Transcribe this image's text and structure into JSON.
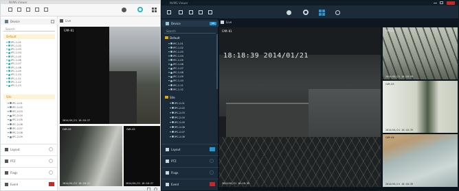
{
  "colors": {
    "light_accent": "#2bb3c0",
    "dark_bg": "#1b2b3a",
    "dark_accent": "#1e9ad6",
    "red": "#c62828"
  },
  "light_window": {
    "title": "NVMS Viewer",
    "icons": [
      "home-icon",
      "play-icon",
      "map-icon",
      "layout-icon",
      "bell-icon",
      "settings-icon",
      "record-icon",
      "grid-icon"
    ],
    "sidebar": {
      "section_device": "Device",
      "search_placeholder": "Search",
      "group1_label": "Default",
      "group1_items": [
        "IPC-1-01",
        "IPC-1-02",
        "IPC-1-03",
        "IPC-1-04",
        "IPC-1-05",
        "IPC-1-06",
        "IPC-1-07",
        "IPC-1-08",
        "IPC-1-09",
        "IPC-1-10",
        "IPC-1-11",
        "IPC-1-12",
        "IPC-1-13"
      ],
      "group2_label": "Site",
      "group2_items": [
        "IPC-2-01",
        "IPC-2-02",
        "IPC-2-03",
        "IPC-2-04",
        "IPC-2-05",
        "IPC-2-06",
        "IPC-2-07",
        "IPC-2-08",
        "IPC-2-09"
      ],
      "bottom_items": [
        {
          "label": "Layout",
          "icon": "layout-icon"
        },
        {
          "label": "PTZ",
          "icon": "ptz-icon"
        },
        {
          "label": "Flags",
          "icon": "flag-icon"
        },
        {
          "label": "Event",
          "icon": "alarm-icon"
        }
      ]
    },
    "main_tab": "Live",
    "feeds": [
      {
        "id": "big",
        "top_label": "CAM-01",
        "bottom_label": "2014/01/21 18:18:27"
      },
      {
        "id": "small1",
        "top_label": "CAM-02",
        "bottom_label": "2014/01/21 18:18:27"
      },
      {
        "id": "small2",
        "top_label": "CAM-03",
        "bottom_label": "2014/01/21 18:18:27"
      }
    ]
  },
  "dark_window": {
    "title": "NVMS Viewer",
    "window_controls": [
      "minimize-icon",
      "maximize-icon",
      "close-icon"
    ],
    "sidebar": {
      "section_device": "Device",
      "badge": "ON",
      "search_placeholder": "Search",
      "group1_label": "Default",
      "group1_items": [
        "IPC-1-01",
        "IPC-1-02",
        "IPC-1-03",
        "IPC-1-04",
        "IPC-1-05",
        "IPC-1-06",
        "IPC-1-07",
        "IPC-1-08",
        "IPC-1-09",
        "IPC-1-10",
        "IPC-1-11",
        "IPC-1-12"
      ],
      "group2_label": "Site",
      "group2_items": [
        "IPC-2-01",
        "IPC-2-02",
        "IPC-2-03",
        "IPC-2-04",
        "IPC-2-05",
        "IPC-2-06",
        "IPC-2-07",
        "IPC-2-08"
      ],
      "bottom_items": [
        {
          "label": "Layout",
          "icon": "layout-icon"
        },
        {
          "label": "PTZ",
          "icon": "ptz-icon"
        },
        {
          "label": "Flags",
          "icon": "flag-icon"
        },
        {
          "label": "Event",
          "icon": "alarm-icon"
        }
      ]
    },
    "main_tab": "Live",
    "main_feed": {
      "top_label": "CAM-01",
      "osd": "18:18:39 2014/01/21",
      "bottom_label": "2014/01/21 18:18:39"
    },
    "side_feeds": [
      {
        "top_label": "CAM-02",
        "bottom_label": "2014/01/21 18:18:39"
      },
      {
        "top_label": "CAM-03",
        "bottom_label": "2014/01/21 18:18:39"
      },
      {
        "top_label": "CAM-04",
        "bottom_label": "2014/01/21 18:18:39"
      }
    ]
  }
}
